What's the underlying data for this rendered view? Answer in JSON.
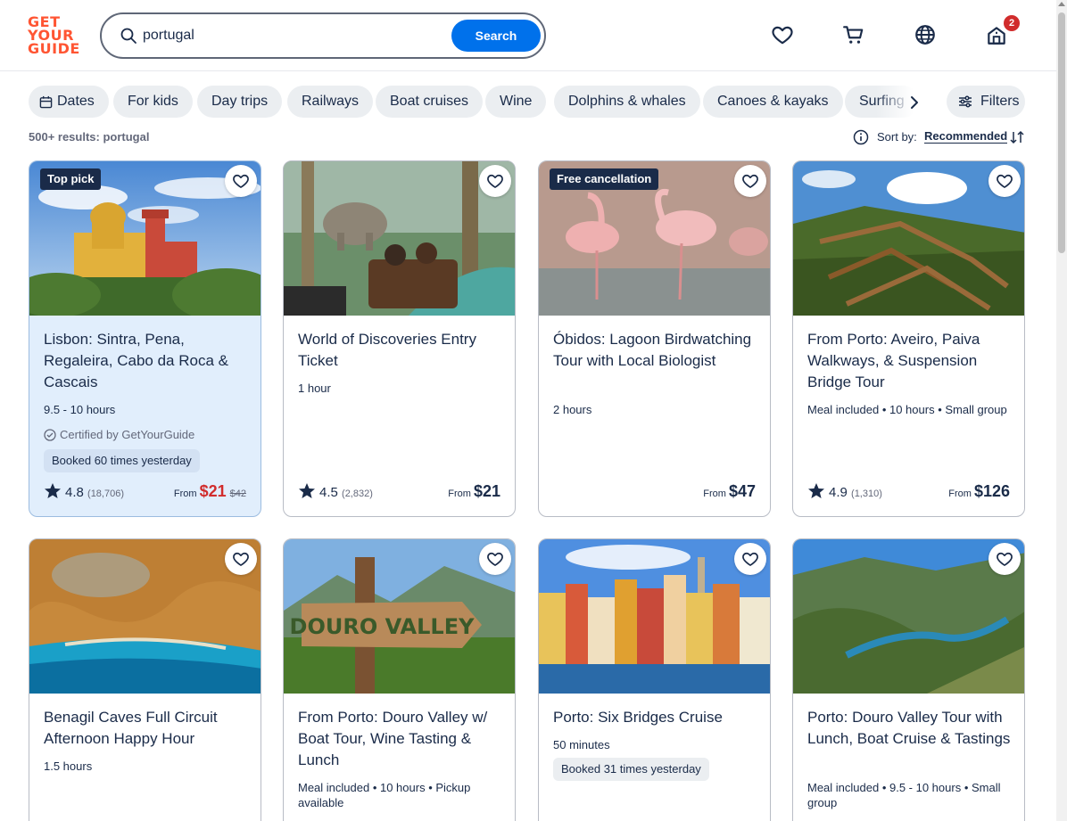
{
  "logo": {
    "line1": "GET",
    "line2": "YOUR",
    "line3": "GUIDE"
  },
  "search": {
    "value": "portugal",
    "button": "Search"
  },
  "header": {
    "cart_count": "2"
  },
  "chips": [
    "Dates",
    "For kids",
    "Day trips",
    "Railways",
    "Boat cruises",
    "Wine",
    "Dolphins & whales",
    "Canoes & kayaks",
    "Surfing"
  ],
  "filters_label": "Filters",
  "results_text": "500+ results: portugal",
  "sort": {
    "label": "Sort by:",
    "value": "Recommended"
  },
  "cards": [
    {
      "badge": "Top pick",
      "title": "Lisbon: Sintra, Pena, Regaleira, Cabo da Roca & Cascais",
      "meta": "9.5 - 10 hours",
      "certified": "Certified by GetYourGuide",
      "booked": "Booked 60 times yesterday",
      "rating": "4.8",
      "reviews": "(18,706)",
      "from": "From",
      "price": "$21",
      "old_price": "$42"
    },
    {
      "title": "World of Discoveries Entry Ticket",
      "meta": "1 hour",
      "rating": "4.5",
      "reviews": "(2,832)",
      "from": "From",
      "price": "$21"
    },
    {
      "badge": "Free cancellation",
      "title": "Óbidos: Lagoon Birdwatching Tour with Local Biologist",
      "meta": "2 hours",
      "from": "From",
      "price": "$47"
    },
    {
      "title": "From Porto: Aveiro, Paiva Walkways, & Suspension Bridge Tour",
      "meta": "Meal included • 10 hours • Small group",
      "rating": "4.9",
      "reviews": "(1,310)",
      "from": "From",
      "price": "$126"
    },
    {
      "title": "Benagil Caves Full Circuit Afternoon Happy Hour",
      "meta": "1.5 hours"
    },
    {
      "title": "From Porto: Douro Valley w/ Boat Tour, Wine Tasting & Lunch",
      "meta": "Meal included • 10 hours • Pickup available",
      "sign_text": "DOURO VALLEY"
    },
    {
      "title": "Porto: Six Bridges Cruise",
      "meta": "50 minutes",
      "booked": "Booked 31 times yesterday"
    },
    {
      "title": "Porto: Douro Valley Tour with Lunch, Boat Cruise & Tastings",
      "meta": "Meal included • 9.5 - 10 hours • Small group"
    }
  ],
  "colors": {
    "brand": "#ff5533",
    "primary": "#0071eb",
    "text": "#1a2b49",
    "deal": "#d12c2c",
    "highlight": "#e1eefc"
  }
}
